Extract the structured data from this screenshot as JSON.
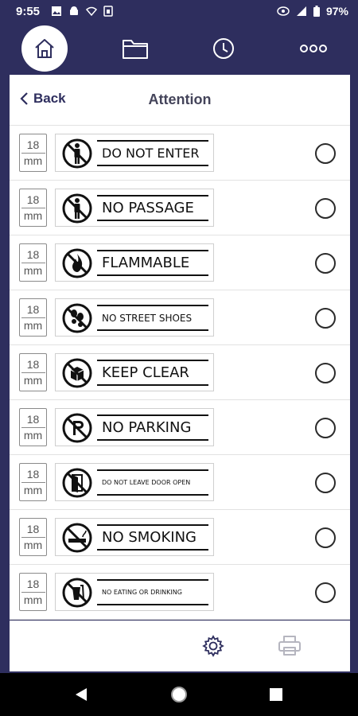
{
  "status_bar": {
    "time": "9:55",
    "battery": "97%"
  },
  "header": {
    "back_label": "Back",
    "title": "Attention"
  },
  "colors": {
    "navy": "#2e2e5e",
    "white": "#ffffff"
  },
  "labels": [
    {
      "size_value": "18",
      "size_unit": "mm",
      "text": "DO NOT ENTER",
      "icon": "no-entry-person-icon"
    },
    {
      "size_value": "18",
      "size_unit": "mm",
      "text": "NO PASSAGE",
      "icon": "no-passage-person-icon"
    },
    {
      "size_value": "18",
      "size_unit": "mm",
      "text": "FLAMMABLE",
      "icon": "no-fire-icon"
    },
    {
      "size_value": "18",
      "size_unit": "mm",
      "text": "NO STREET SHOES",
      "icon": "no-shoes-icon"
    },
    {
      "size_value": "18",
      "size_unit": "mm",
      "text": "KEEP CLEAR",
      "icon": "keep-clear-box-icon"
    },
    {
      "size_value": "18",
      "size_unit": "mm",
      "text": "NO PARKING",
      "icon": "no-parking-icon"
    },
    {
      "size_value": "18",
      "size_unit": "mm",
      "text": "DO NOT LEAVE DOOR OPEN",
      "icon": "door-open-icon"
    },
    {
      "size_value": "18",
      "size_unit": "mm",
      "text": "NO SMOKING",
      "icon": "no-smoking-icon"
    },
    {
      "size_value": "18",
      "size_unit": "mm",
      "text": "NO EATING OR DRINKING",
      "icon": "no-eating-drinking-icon"
    }
  ]
}
